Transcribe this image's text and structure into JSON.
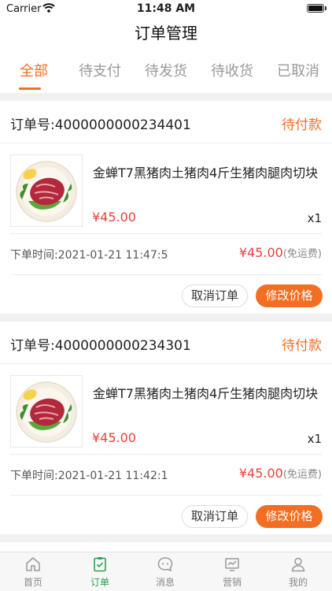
{
  "status_bar": {
    "carrier": "Carrier",
    "time": "11:48 AM"
  },
  "nav": {
    "title": "订单管理"
  },
  "tabs": [
    {
      "label": "全部",
      "active": true
    },
    {
      "label": "待支付",
      "active": false
    },
    {
      "label": "待发货",
      "active": false
    },
    {
      "label": "待收货",
      "active": false
    },
    {
      "label": "已取消",
      "active": false
    }
  ],
  "orders": [
    {
      "order_no": "订单号:4000000000234401",
      "status": "待付款",
      "product_name": "金蝉T7黑猪肉土猪肉4斤生猪肉腿肉切块",
      "price": "¥45.00",
      "quantity": "x1",
      "order_time": "下单时间:2021-01-21 11:47:58",
      "total": "¥45.00",
      "shipping": "(免运费)",
      "cancel_label": "取消订单",
      "modify_label": "修改价格"
    },
    {
      "order_no": "订单号:4000000000234301",
      "status": "待付款",
      "product_name": "金蝉T7黑猪肉土猪肉4斤生猪肉腿肉切块",
      "price": "¥45.00",
      "quantity": "x1",
      "order_time": "下单时间:2021-01-21 11:42:10",
      "total": "¥45.00",
      "shipping": "(免运费)",
      "cancel_label": "取消订单",
      "modify_label": "修改价格"
    }
  ],
  "bottom_tabs": [
    {
      "label": "首页",
      "icon": "home-icon",
      "active": false
    },
    {
      "label": "订单",
      "icon": "order-clipboard-icon",
      "active": true
    },
    {
      "label": "消息",
      "icon": "message-icon",
      "active": false
    },
    {
      "label": "营销",
      "icon": "marketing-chart-icon",
      "active": false
    },
    {
      "label": "我的",
      "icon": "profile-icon",
      "active": false
    }
  ],
  "colors": {
    "accent": "#f26e23",
    "price": "#e8413a",
    "active_tab": "#2aa052"
  }
}
